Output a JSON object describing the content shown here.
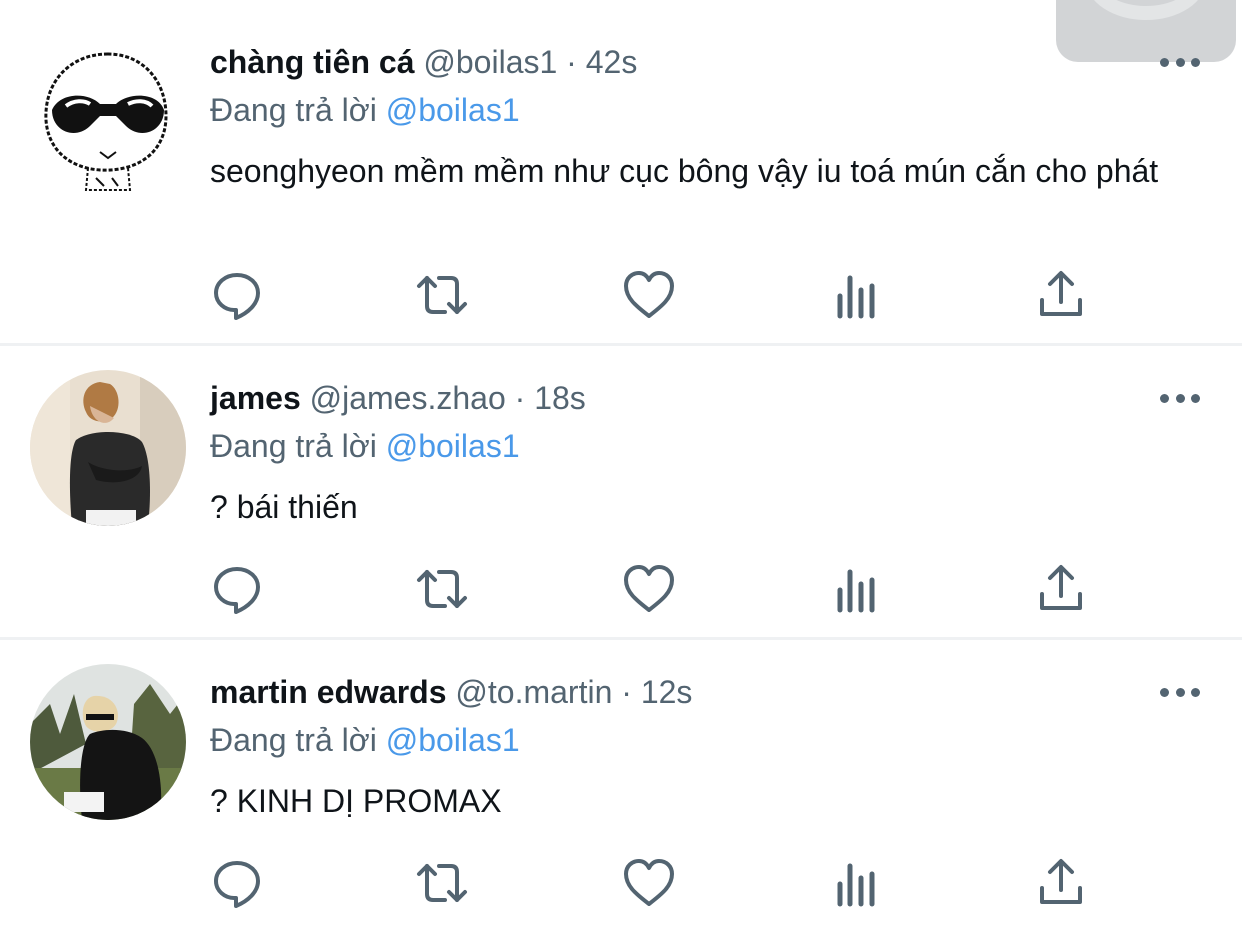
{
  "tweets": [
    {
      "name": "chàng tiên cá",
      "handle": "@boilas1",
      "dot": "·",
      "time": "42s",
      "reply_prefix": "Đang trả lời",
      "reply_to": "@boilas1",
      "text": "seonghyeon mềm mềm như cục bông vậy iu toá mún cắn cho phát",
      "avatar_icon": "sunglasses-meme-face-avatar"
    },
    {
      "name": "james",
      "handle": "@james.zhao",
      "dot": "·",
      "time": "18s",
      "reply_prefix": "Đang trả lời",
      "reply_to": "@boilas1",
      "text": "? bái thiến",
      "avatar_icon": "photo-avatar"
    },
    {
      "name": "martin edwards",
      "handle": "@to.martin",
      "dot": "·",
      "time": "12s",
      "reply_prefix": "Đang trả lời",
      "reply_to": "@boilas1",
      "text": "? KINH DỊ PROMAX",
      "avatar_icon": "photo-avatar"
    }
  ],
  "actions": [
    "reply-icon",
    "retweet-icon",
    "like-icon",
    "views-icon",
    "share-icon"
  ],
  "colors": {
    "text": "#0f1419",
    "secondary": "#536471",
    "mention": "#4a99e9",
    "divider": "#eff1f3"
  }
}
